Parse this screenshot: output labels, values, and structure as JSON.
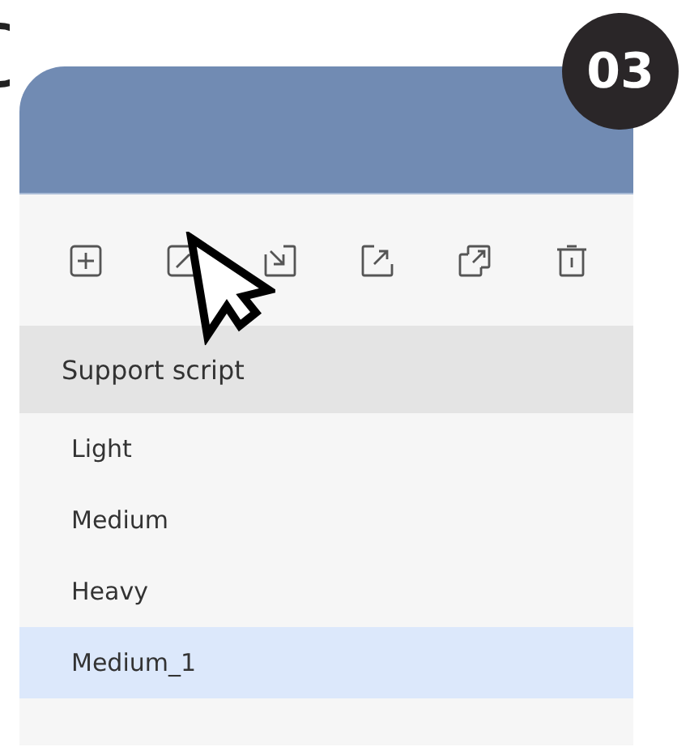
{
  "step_badge": "03",
  "toolbar": [
    {
      "kind": "add"
    },
    {
      "kind": "expand"
    },
    {
      "kind": "import"
    },
    {
      "kind": "export"
    },
    {
      "kind": "copy"
    },
    {
      "kind": "delete"
    }
  ],
  "list": {
    "header": "Support script",
    "items": [
      {
        "label": "Light",
        "selected": false
      },
      {
        "label": "Medium",
        "selected": false
      },
      {
        "label": "Heavy",
        "selected": false
      },
      {
        "label": "Medium_1",
        "selected": true
      }
    ]
  }
}
